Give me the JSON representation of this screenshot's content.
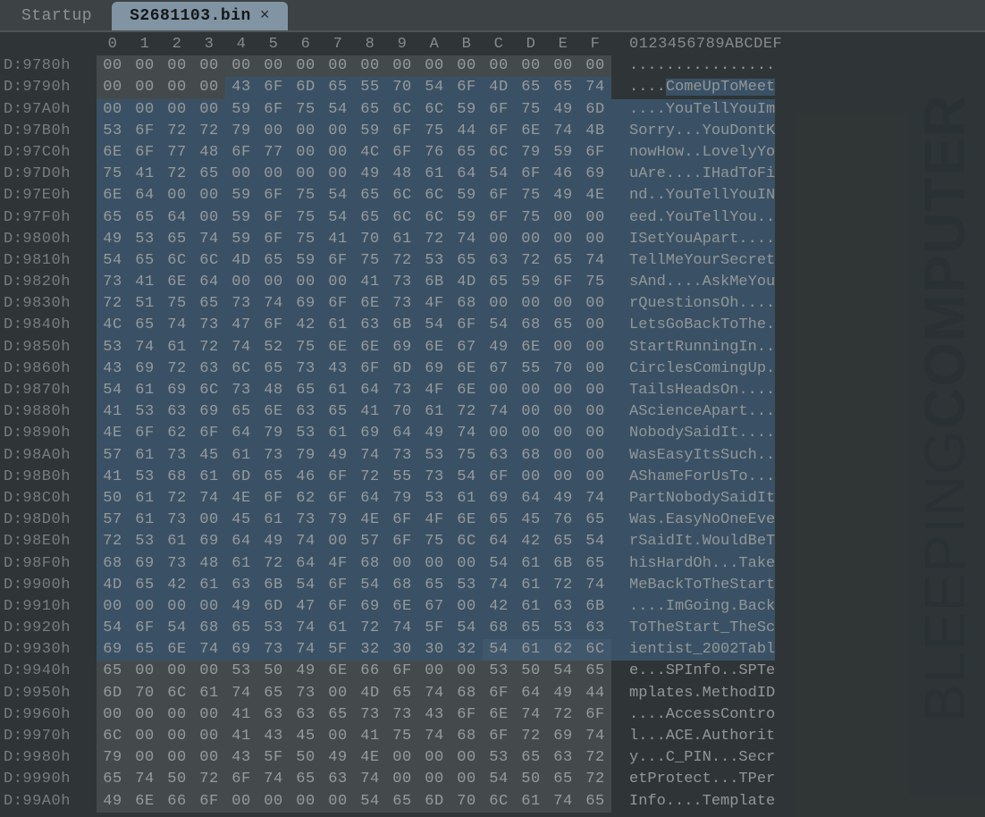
{
  "tabs": {
    "inactive": "Startup",
    "active": "S2681103.bin"
  },
  "columns_hex": [
    "0",
    "1",
    "2",
    "3",
    "4",
    "5",
    "6",
    "7",
    "8",
    "9",
    "A",
    "B",
    "C",
    "D",
    "E",
    "F"
  ],
  "columns_ascii": "0123456789ABCDEF",
  "watermark_light": "BLEEPING",
  "watermark_bold": "COMPUTER",
  "rows": [
    {
      "off": "D:9780h",
      "hex": [
        "00",
        "00",
        "00",
        "00",
        "00",
        "00",
        "00",
        "00",
        "00",
        "00",
        "00",
        "00",
        "00",
        "00",
        "00",
        "00"
      ],
      "ascii": "................",
      "sel": "none",
      "ascii_sel": "none"
    },
    {
      "off": "D:9790h",
      "hex": [
        "00",
        "00",
        "00",
        "00",
        "43",
        "6F",
        "6D",
        "65",
        "55",
        "70",
        "54",
        "6F",
        "4D",
        "65",
        "65",
        "74"
      ],
      "ascii": "....ComeUpToMeet",
      "sel": "from4",
      "ascii_sel": "from4"
    },
    {
      "off": "D:97A0h",
      "hex": [
        "00",
        "00",
        "00",
        "00",
        "59",
        "6F",
        "75",
        "54",
        "65",
        "6C",
        "6C",
        "59",
        "6F",
        "75",
        "49",
        "6D"
      ],
      "ascii": "....YouTellYouIm",
      "sel": "full",
      "ascii_sel": "full"
    },
    {
      "off": "D:97B0h",
      "hex": [
        "53",
        "6F",
        "72",
        "72",
        "79",
        "00",
        "00",
        "00",
        "59",
        "6F",
        "75",
        "44",
        "6F",
        "6E",
        "74",
        "4B"
      ],
      "ascii": "Sorry...YouDontK",
      "sel": "full",
      "ascii_sel": "full"
    },
    {
      "off": "D:97C0h",
      "hex": [
        "6E",
        "6F",
        "77",
        "48",
        "6F",
        "77",
        "00",
        "00",
        "4C",
        "6F",
        "76",
        "65",
        "6C",
        "79",
        "59",
        "6F"
      ],
      "ascii": "nowHow..LovelyYo",
      "sel": "full",
      "ascii_sel": "full"
    },
    {
      "off": "D:97D0h",
      "hex": [
        "75",
        "41",
        "72",
        "65",
        "00",
        "00",
        "00",
        "00",
        "49",
        "48",
        "61",
        "64",
        "54",
        "6F",
        "46",
        "69"
      ],
      "ascii": "uAre....IHadToFi",
      "sel": "full",
      "ascii_sel": "full"
    },
    {
      "off": "D:97E0h",
      "hex": [
        "6E",
        "64",
        "00",
        "00",
        "59",
        "6F",
        "75",
        "54",
        "65",
        "6C",
        "6C",
        "59",
        "6F",
        "75",
        "49",
        "4E"
      ],
      "ascii": "nd..YouTellYouIN",
      "sel": "full",
      "ascii_sel": "full"
    },
    {
      "off": "D:97F0h",
      "hex": [
        "65",
        "65",
        "64",
        "00",
        "59",
        "6F",
        "75",
        "54",
        "65",
        "6C",
        "6C",
        "59",
        "6F",
        "75",
        "00",
        "00"
      ],
      "ascii": "eed.YouTellYou..",
      "sel": "full",
      "ascii_sel": "full"
    },
    {
      "off": "D:9800h",
      "hex": [
        "49",
        "53",
        "65",
        "74",
        "59",
        "6F",
        "75",
        "41",
        "70",
        "61",
        "72",
        "74",
        "00",
        "00",
        "00",
        "00"
      ],
      "ascii": "ISetYouApart....",
      "sel": "full",
      "ascii_sel": "full"
    },
    {
      "off": "D:9810h",
      "hex": [
        "54",
        "65",
        "6C",
        "6C",
        "4D",
        "65",
        "59",
        "6F",
        "75",
        "72",
        "53",
        "65",
        "63",
        "72",
        "65",
        "74"
      ],
      "ascii": "TellMeYourSecret",
      "sel": "full",
      "ascii_sel": "full"
    },
    {
      "off": "D:9820h",
      "hex": [
        "73",
        "41",
        "6E",
        "64",
        "00",
        "00",
        "00",
        "00",
        "41",
        "73",
        "6B",
        "4D",
        "65",
        "59",
        "6F",
        "75"
      ],
      "ascii": "sAnd....AskMeYou",
      "sel": "full",
      "ascii_sel": "full"
    },
    {
      "off": "D:9830h",
      "hex": [
        "72",
        "51",
        "75",
        "65",
        "73",
        "74",
        "69",
        "6F",
        "6E",
        "73",
        "4F",
        "68",
        "00",
        "00",
        "00",
        "00"
      ],
      "ascii": "rQuestionsOh....",
      "sel": "full",
      "ascii_sel": "full"
    },
    {
      "off": "D:9840h",
      "hex": [
        "4C",
        "65",
        "74",
        "73",
        "47",
        "6F",
        "42",
        "61",
        "63",
        "6B",
        "54",
        "6F",
        "54",
        "68",
        "65",
        "00"
      ],
      "ascii": "LetsGoBackToThe.",
      "sel": "full",
      "ascii_sel": "full"
    },
    {
      "off": "D:9850h",
      "hex": [
        "53",
        "74",
        "61",
        "72",
        "74",
        "52",
        "75",
        "6E",
        "6E",
        "69",
        "6E",
        "67",
        "49",
        "6E",
        "00",
        "00"
      ],
      "ascii": "StartRunningIn..",
      "sel": "full",
      "ascii_sel": "full"
    },
    {
      "off": "D:9860h",
      "hex": [
        "43",
        "69",
        "72",
        "63",
        "6C",
        "65",
        "73",
        "43",
        "6F",
        "6D",
        "69",
        "6E",
        "67",
        "55",
        "70",
        "00"
      ],
      "ascii": "CirclesComingUp.",
      "sel": "full",
      "ascii_sel": "full"
    },
    {
      "off": "D:9870h",
      "hex": [
        "54",
        "61",
        "69",
        "6C",
        "73",
        "48",
        "65",
        "61",
        "64",
        "73",
        "4F",
        "6E",
        "00",
        "00",
        "00",
        "00"
      ],
      "ascii": "TailsHeadsOn....",
      "sel": "full",
      "ascii_sel": "full"
    },
    {
      "off": "D:9880h",
      "hex": [
        "41",
        "53",
        "63",
        "69",
        "65",
        "6E",
        "63",
        "65",
        "41",
        "70",
        "61",
        "72",
        "74",
        "00",
        "00",
        "00"
      ],
      "ascii": "AScienceApart...",
      "sel": "full",
      "ascii_sel": "full"
    },
    {
      "off": "D:9890h",
      "hex": [
        "4E",
        "6F",
        "62",
        "6F",
        "64",
        "79",
        "53",
        "61",
        "69",
        "64",
        "49",
        "74",
        "00",
        "00",
        "00",
        "00"
      ],
      "ascii": "NobodySaidIt....",
      "sel": "full",
      "ascii_sel": "full"
    },
    {
      "off": "D:98A0h",
      "hex": [
        "57",
        "61",
        "73",
        "45",
        "61",
        "73",
        "79",
        "49",
        "74",
        "73",
        "53",
        "75",
        "63",
        "68",
        "00",
        "00"
      ],
      "ascii": "WasEasyItsSuch..",
      "sel": "full",
      "ascii_sel": "full"
    },
    {
      "off": "D:98B0h",
      "hex": [
        "41",
        "53",
        "68",
        "61",
        "6D",
        "65",
        "46",
        "6F",
        "72",
        "55",
        "73",
        "54",
        "6F",
        "00",
        "00",
        "00"
      ],
      "ascii": "AShameForUsTo...",
      "sel": "full",
      "ascii_sel": "full"
    },
    {
      "off": "D:98C0h",
      "hex": [
        "50",
        "61",
        "72",
        "74",
        "4E",
        "6F",
        "62",
        "6F",
        "64",
        "79",
        "53",
        "61",
        "69",
        "64",
        "49",
        "74"
      ],
      "ascii": "PartNobodySaidIt",
      "sel": "full",
      "ascii_sel": "full"
    },
    {
      "off": "D:98D0h",
      "hex": [
        "57",
        "61",
        "73",
        "00",
        "45",
        "61",
        "73",
        "79",
        "4E",
        "6F",
        "4F",
        "6E",
        "65",
        "45",
        "76",
        "65"
      ],
      "ascii": "Was.EasyNoOneEve",
      "sel": "full",
      "ascii_sel": "full"
    },
    {
      "off": "D:98E0h",
      "hex": [
        "72",
        "53",
        "61",
        "69",
        "64",
        "49",
        "74",
        "00",
        "57",
        "6F",
        "75",
        "6C",
        "64",
        "42",
        "65",
        "54"
      ],
      "ascii": "rSaidIt.WouldBeT",
      "sel": "full",
      "ascii_sel": "full"
    },
    {
      "off": "D:98F0h",
      "hex": [
        "68",
        "69",
        "73",
        "48",
        "61",
        "72",
        "64",
        "4F",
        "68",
        "00",
        "00",
        "00",
        "54",
        "61",
        "6B",
        "65"
      ],
      "ascii": "hisHardOh...Take",
      "sel": "full",
      "ascii_sel": "full"
    },
    {
      "off": "D:9900h",
      "hex": [
        "4D",
        "65",
        "42",
        "61",
        "63",
        "6B",
        "54",
        "6F",
        "54",
        "68",
        "65",
        "53",
        "74",
        "61",
        "72",
        "74"
      ],
      "ascii": "MeBackToTheStart",
      "sel": "full",
      "ascii_sel": "full"
    },
    {
      "off": "D:9910h",
      "hex": [
        "00",
        "00",
        "00",
        "00",
        "49",
        "6D",
        "47",
        "6F",
        "69",
        "6E",
        "67",
        "00",
        "42",
        "61",
        "63",
        "6B"
      ],
      "ascii": "....ImGoing.Back",
      "sel": "full",
      "ascii_sel": "full"
    },
    {
      "off": "D:9920h",
      "hex": [
        "54",
        "6F",
        "54",
        "68",
        "65",
        "53",
        "74",
        "61",
        "72",
        "74",
        "5F",
        "54",
        "68",
        "65",
        "53",
        "63"
      ],
      "ascii": "ToTheStart_TheSc",
      "sel": "full",
      "ascii_sel": "full"
    },
    {
      "off": "D:9930h",
      "hex": [
        "69",
        "65",
        "6E",
        "74",
        "69",
        "73",
        "74",
        "5F",
        "32",
        "30",
        "30",
        "32",
        "54",
        "61",
        "62",
        "6C"
      ],
      "ascii": "ientist_2002Tabl",
      "sel": "to11",
      "ascii_sel": "full"
    },
    {
      "off": "D:9940h",
      "hex": [
        "65",
        "00",
        "00",
        "00",
        "53",
        "50",
        "49",
        "6E",
        "66",
        "6F",
        "00",
        "00",
        "53",
        "50",
        "54",
        "65"
      ],
      "ascii": "e...SPInfo..SPTe",
      "sel": "none",
      "ascii_sel": "none"
    },
    {
      "off": "D:9950h",
      "hex": [
        "6D",
        "70",
        "6C",
        "61",
        "74",
        "65",
        "73",
        "00",
        "4D",
        "65",
        "74",
        "68",
        "6F",
        "64",
        "49",
        "44"
      ],
      "ascii": "mplates.MethodID",
      "sel": "none",
      "ascii_sel": "none"
    },
    {
      "off": "D:9960h",
      "hex": [
        "00",
        "00",
        "00",
        "00",
        "41",
        "63",
        "63",
        "65",
        "73",
        "73",
        "43",
        "6F",
        "6E",
        "74",
        "72",
        "6F"
      ],
      "ascii": "....AccessContro",
      "sel": "none",
      "ascii_sel": "none"
    },
    {
      "off": "D:9970h",
      "hex": [
        "6C",
        "00",
        "00",
        "00",
        "41",
        "43",
        "45",
        "00",
        "41",
        "75",
        "74",
        "68",
        "6F",
        "72",
        "69",
        "74"
      ],
      "ascii": "l...ACE.Authorit",
      "sel": "none",
      "ascii_sel": "none"
    },
    {
      "off": "D:9980h",
      "hex": [
        "79",
        "00",
        "00",
        "00",
        "43",
        "5F",
        "50",
        "49",
        "4E",
        "00",
        "00",
        "00",
        "53",
        "65",
        "63",
        "72"
      ],
      "ascii": "y...C_PIN...Secr",
      "sel": "none",
      "ascii_sel": "none"
    },
    {
      "off": "D:9990h",
      "hex": [
        "65",
        "74",
        "50",
        "72",
        "6F",
        "74",
        "65",
        "63",
        "74",
        "00",
        "00",
        "00",
        "54",
        "50",
        "65",
        "72"
      ],
      "ascii": "etProtect...TPer",
      "sel": "none",
      "ascii_sel": "none"
    },
    {
      "off": "D:99A0h",
      "hex": [
        "49",
        "6E",
        "66",
        "6F",
        "00",
        "00",
        "00",
        "00",
        "54",
        "65",
        "6D",
        "70",
        "6C",
        "61",
        "74",
        "65"
      ],
      "ascii": "Info....Template",
      "sel": "none",
      "ascii_sel": "none"
    }
  ]
}
